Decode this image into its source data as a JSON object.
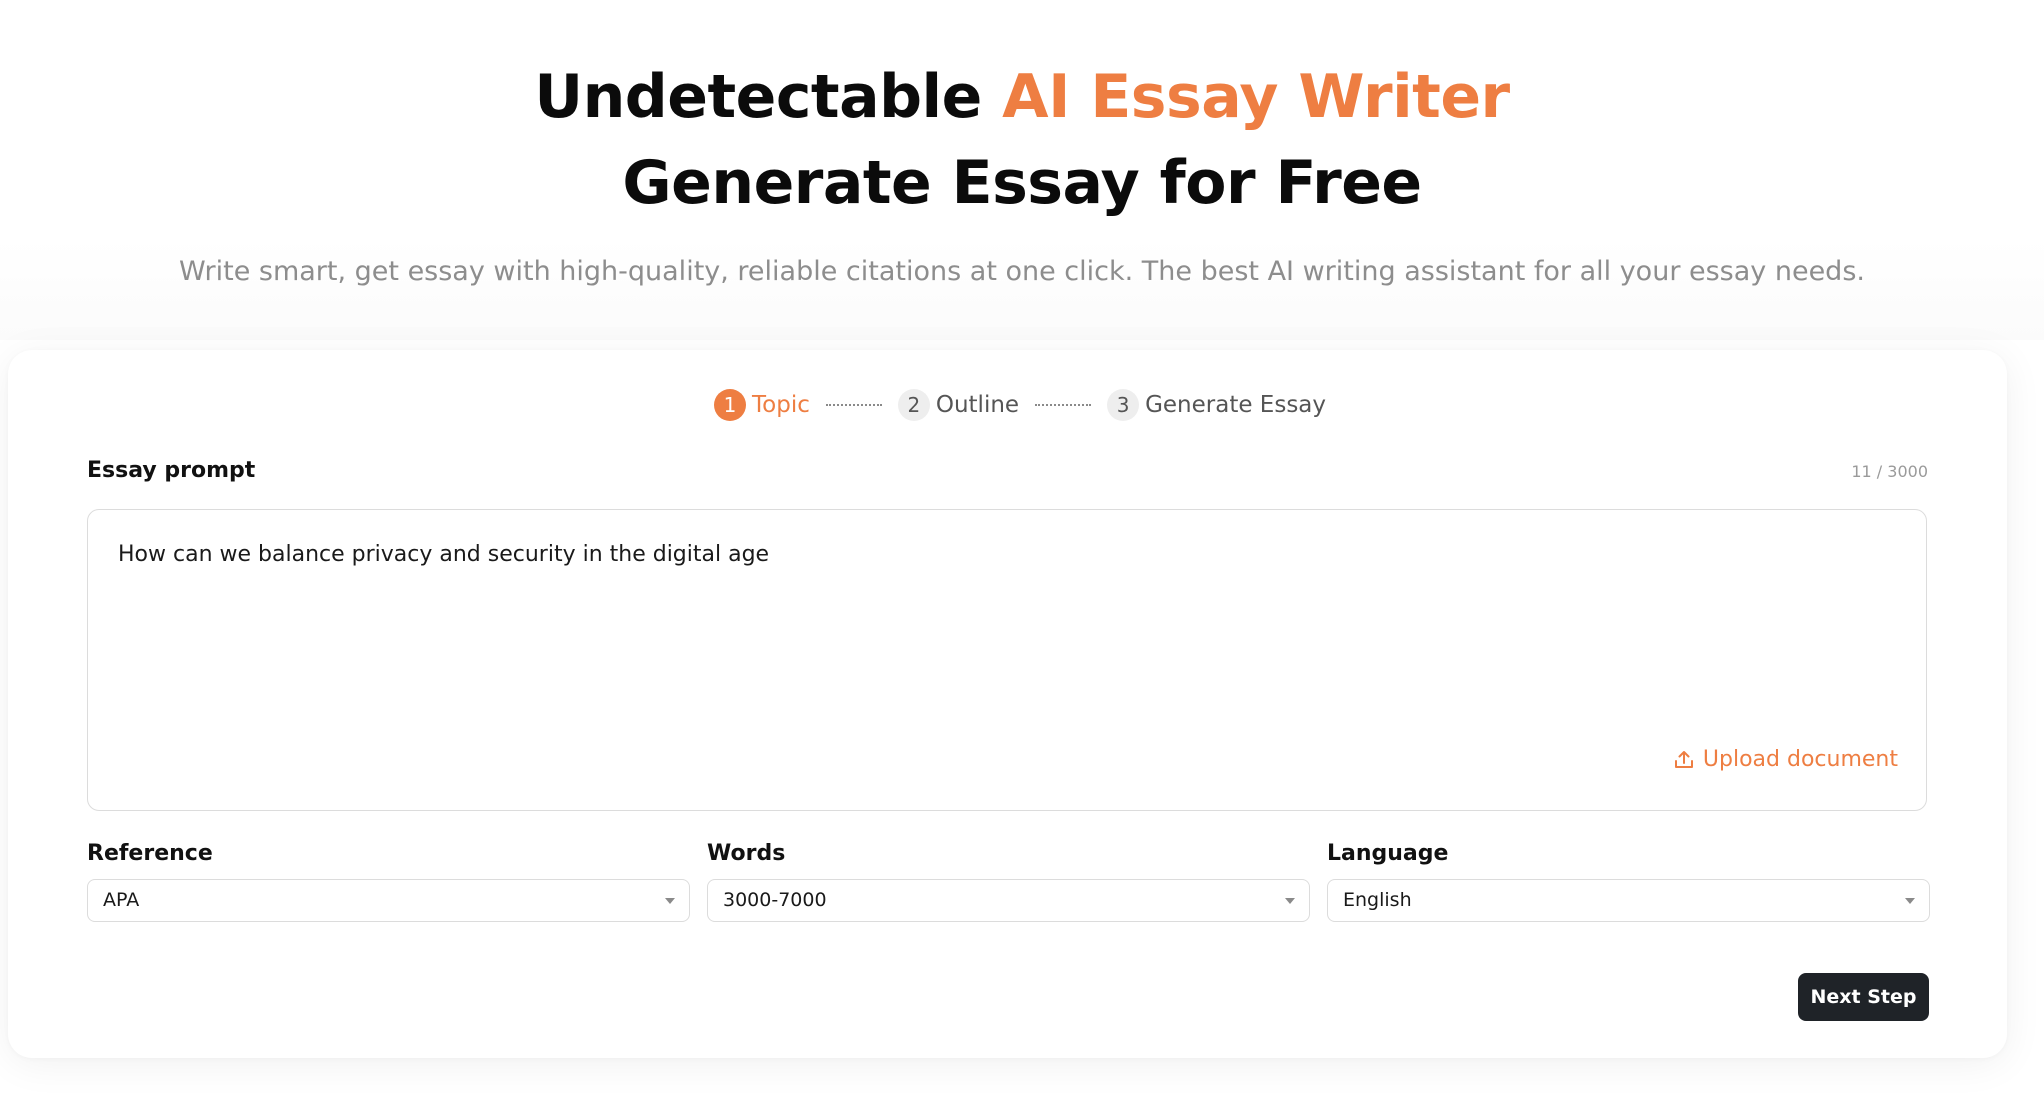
{
  "hero": {
    "title_part1": "Undetectable ",
    "title_accent": "AI Essay Writer",
    "title_line2": "Generate Essay for Free",
    "subtitle": "Write smart, get essay with high-quality, reliable citations at one click. The best AI writing assistant for all your essay needs.",
    "accent_color": "#ee7e42"
  },
  "steps": [
    {
      "number": "1",
      "label": "Topic",
      "active": true
    },
    {
      "number": "2",
      "label": "Outline",
      "active": false
    },
    {
      "number": "3",
      "label": "Generate Essay",
      "active": false
    }
  ],
  "prompt": {
    "label": "Essay prompt",
    "counter": "11 / 3000",
    "value": "How can we balance privacy and security in the digital age",
    "upload_label": "Upload document",
    "upload_icon": "upload-icon"
  },
  "options": {
    "reference": {
      "label": "Reference",
      "value": "APA"
    },
    "words": {
      "label": "Words",
      "value": "3000-7000"
    },
    "language": {
      "label": "Language",
      "value": "English"
    }
  },
  "actions": {
    "next_label": "Next Step",
    "next_bg": "#1f2328"
  }
}
